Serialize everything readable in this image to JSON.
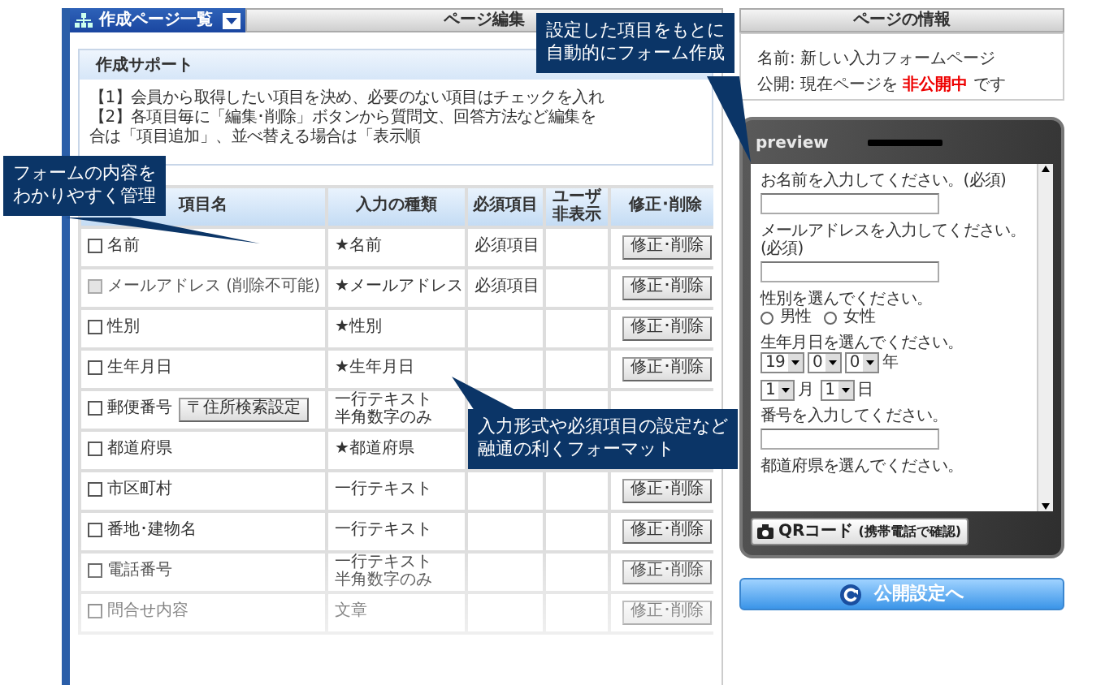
{
  "left_panel": {
    "tab": "作成ページ一覧",
    "title": "ページ編集"
  },
  "support": {
    "title": "作成サポート",
    "lines": [
      "【1】会員から取得したい項目を決め、必要のない項目はチェックを入れ",
      "【2】各項目毎に「編集･削除」ボタンから質問文、回答方法など編集を",
      "合は「項目追加」、並べ替える場合は「表示順"
    ]
  },
  "table": {
    "columns": [
      "項目名",
      "入力の種類",
      "必須項目",
      "ユーザ非表示",
      "修正･削除"
    ],
    "rows": [
      {
        "name": "名前",
        "checked": false,
        "disabled": false,
        "type": [
          "★名前"
        ],
        "required": "必須項目",
        "action": "修正･削除"
      },
      {
        "name": "メールアドレス (削除不可能)",
        "checked": false,
        "disabled": true,
        "type": [
          "★メールアドレス"
        ],
        "required": "必須項目",
        "action": "修正･削除"
      },
      {
        "name": "性別",
        "checked": false,
        "disabled": false,
        "type": [
          "★性別"
        ],
        "action": "修正･削除"
      },
      {
        "name": "生年月日",
        "checked": false,
        "disabled": false,
        "type": [
          "★生年月日"
        ],
        "action": "修正･削除"
      },
      {
        "name": "郵便番号",
        "checked": false,
        "disabled": false,
        "extra_button": "〒住所検索設定",
        "type": [
          "一行テキスト",
          "半角数字のみ"
        ]
      },
      {
        "name": "都道府県",
        "checked": false,
        "disabled": false,
        "type": [
          "★都道府県"
        ]
      },
      {
        "name": "市区町村",
        "checked": false,
        "disabled": false,
        "type": [
          "一行テキスト"
        ],
        "action": "修正･削除"
      },
      {
        "name": "番地･建物名",
        "checked": false,
        "disabled": false,
        "type": [
          "一行テキスト"
        ],
        "action": "修正･削除"
      },
      {
        "name": "電話番号",
        "checked": false,
        "disabled": false,
        "type": [
          "一行テキスト",
          "半角数字のみ"
        ],
        "action": "修正･削除"
      },
      {
        "name": "問合せ内容",
        "checked": false,
        "disabled": false,
        "type": [
          "文章"
        ],
        "action": "修正･削除"
      }
    ]
  },
  "info": {
    "title": "ページの情報",
    "lines": [
      "名前: 新しい入力フォームページ",
      "公開: 現在ページを **非公開中** です"
    ]
  },
  "preview": {
    "logo": "preview",
    "fields": [
      {
        "kind": "label",
        "text": "お名前を入力してください。(必須)"
      },
      {
        "kind": "input"
      },
      {
        "kind": "label",
        "text": "メールアドレスを入力してください。"
      },
      {
        "kind": "label",
        "text": "(必須)"
      },
      {
        "kind": "input"
      },
      {
        "kind": "label",
        "text": "性別を選んでください。"
      },
      {
        "kind": "radio",
        "options": [
          {
            "label": "男性",
            "selected": false
          },
          {
            "label": "女性",
            "selected": false
          }
        ]
      },
      {
        "kind": "label",
        "text": "生年月日を選んでください。"
      },
      {
        "kind": "selects",
        "parts": [
          {
            "kind": "select",
            "value": "19"
          },
          {
            "kind": "select",
            "value": "0"
          },
          {
            "kind": "select",
            "value": "0"
          },
          {
            "kind": "unit",
            "text": "年"
          }
        ]
      },
      {
        "kind": "selects",
        "parts": [
          {
            "kind": "select",
            "value": "1"
          },
          {
            "kind": "unit",
            "text": "月"
          },
          {
            "kind": "select",
            "value": "1"
          },
          {
            "kind": "unit",
            "text": "日"
          }
        ]
      },
      {
        "kind": "label",
        "text": "番号を入力してください。"
      },
      {
        "kind": "input"
      },
      {
        "kind": "label",
        "text": "都道府県を選んでください。"
      }
    ],
    "qr_button": {
      "label": "QRコード",
      "note": "(携帯電話で確認)"
    }
  },
  "publish_button": "公開設定へ",
  "callouts": [
    {
      "lines": [
        "フォームの内容を",
        "わかりやすく管理"
      ]
    },
    {
      "lines": [
        "設定した項目をもとに",
        "自動的にフォーム作成"
      ]
    },
    {
      "lines": [
        "入力形式や必須項目の設定など",
        "融通の利くフォーマット"
      ]
    }
  ]
}
